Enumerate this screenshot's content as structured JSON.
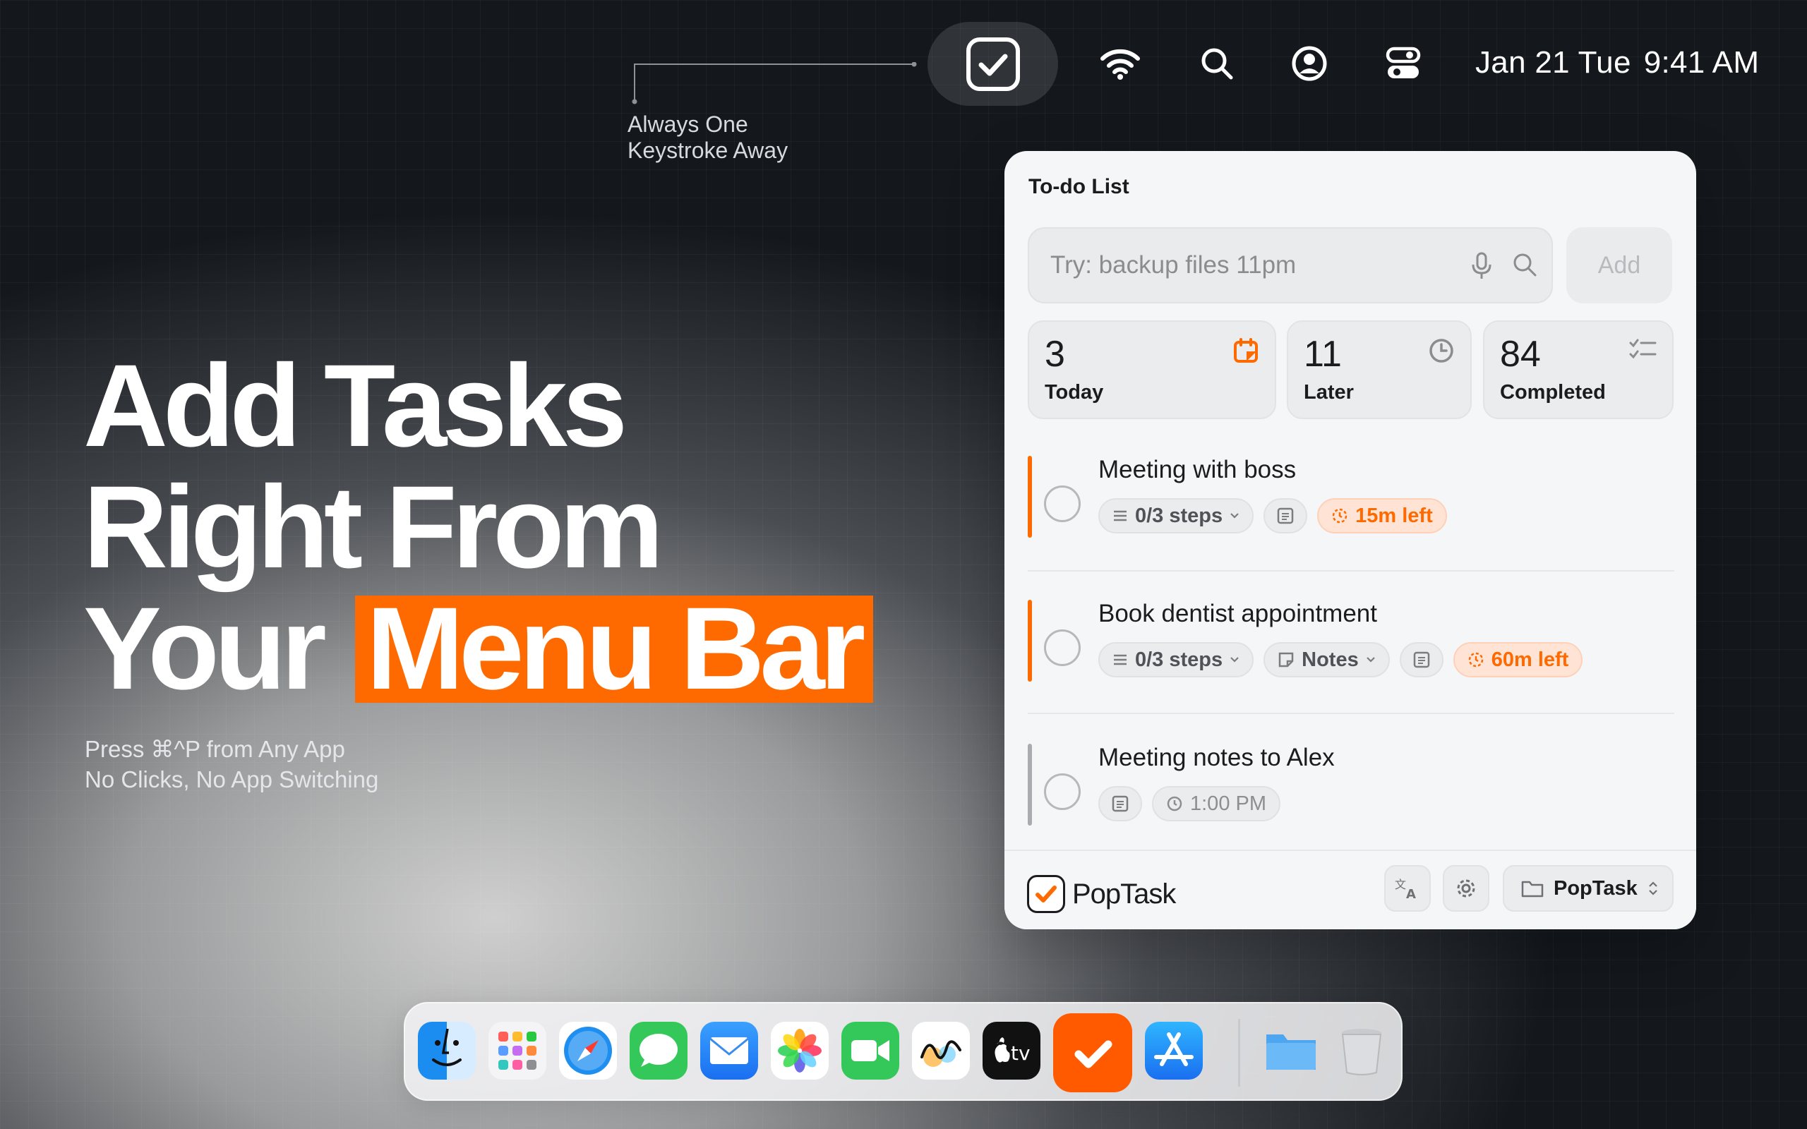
{
  "menubar": {
    "date": "Jan 21 Tue",
    "time": "9:41 AM",
    "icons": [
      "poptask-check-icon",
      "wifi-icon",
      "search-icon",
      "user-icon",
      "control-center-icon"
    ]
  },
  "callout": {
    "line1": "Always One",
    "line2": "Keystroke Away"
  },
  "hero": {
    "line1": "Add Tasks",
    "line2": "Right From",
    "line3_plain": "Your",
    "line3_highlight": "Menu Bar",
    "sub1": "Press ⌘^P from Any App",
    "sub2": "No Clicks, No App Switching"
  },
  "colors": {
    "accent": "#ff6a00",
    "panel_bg": "#f5f6f7",
    "chip_orange_bg": "#ffe4d6"
  },
  "panel": {
    "title": "To-do List",
    "search_placeholder": "Try: backup files 11pm",
    "add_label": "Add",
    "stats": [
      {
        "value": "3",
        "label": "Today",
        "icon": "calendar-icon"
      },
      {
        "value": "11",
        "label": "Later",
        "icon": "clock-icon"
      },
      {
        "value": "84",
        "label": "Completed",
        "icon": "checklist-icon"
      }
    ],
    "tasks": [
      {
        "title": "Meeting with boss",
        "steps": "0/3 steps",
        "remaining": "15m left"
      },
      {
        "title": "Book dentist appointment",
        "steps": "0/3 steps",
        "notes": "Notes",
        "remaining": "60m left"
      },
      {
        "title": "Meeting notes to Alex",
        "time": "1:00 PM"
      }
    ],
    "footer": {
      "brand": "PopTask",
      "project": "PopTask"
    }
  },
  "dock": {
    "apps": [
      "finder-icon",
      "launchpad-icon",
      "safari-icon",
      "messages-icon",
      "mail-icon",
      "photos-icon",
      "facetime-icon",
      "freeform-icon",
      "apple-tv-icon",
      "poptask-icon",
      "app-store-icon",
      "folder-icon",
      "trash-icon"
    ],
    "tv_label": "tv"
  }
}
